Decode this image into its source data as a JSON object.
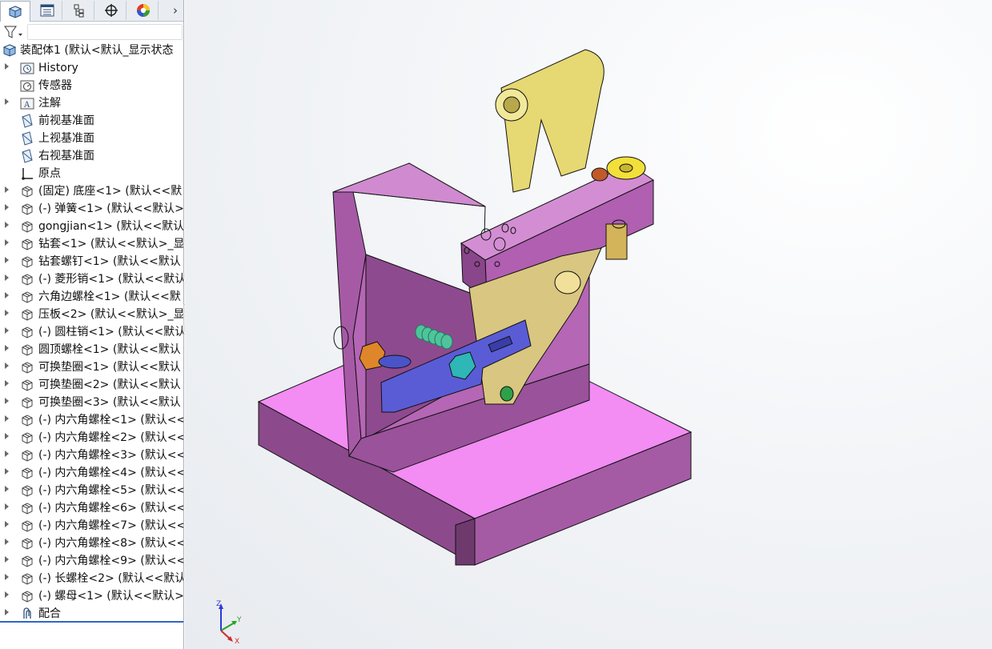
{
  "tabs": [
    {
      "name": "feature-manager-tab",
      "icon": "feature-manager-icon",
      "active": true
    },
    {
      "name": "property-manager-tab",
      "icon": "property-manager-icon",
      "active": false
    },
    {
      "name": "configuration-manager-tab",
      "icon": "configuration-manager-icon",
      "active": false
    },
    {
      "name": "dimxpert-manager-tab",
      "icon": "crosshair-icon",
      "active": false
    },
    {
      "name": "display-manager-tab",
      "icon": "display-manager-icon",
      "active": false
    }
  ],
  "tabs_more": "›",
  "filter": {
    "icon": "filter-icon",
    "value": ""
  },
  "tree": {
    "root": "装配体1  (默认<默认_显示状态",
    "items": [
      {
        "label": "History",
        "icon": "history-folder-icon",
        "expandable": true
      },
      {
        "label": "传感器",
        "icon": "sensor-folder-icon",
        "expandable": false
      },
      {
        "label": "注解",
        "icon": "annotation-folder-icon",
        "expandable": true
      },
      {
        "label": "前视基准面",
        "icon": "plane-icon",
        "expandable": false
      },
      {
        "label": "上视基准面",
        "icon": "plane-icon",
        "expandable": false
      },
      {
        "label": "右视基准面",
        "icon": "plane-icon",
        "expandable": false
      },
      {
        "label": "原点",
        "icon": "origin-icon",
        "expandable": false
      },
      {
        "label": "(固定) 底座<1> (默认<<默",
        "icon": "part-icon",
        "expandable": true
      },
      {
        "label": "(-) 弹簧<1> (默认<<默认>",
        "icon": "part-icon",
        "expandable": true
      },
      {
        "label": "gongjian<1> (默认<<默认",
        "icon": "part-icon",
        "expandable": true
      },
      {
        "label": "钻套<1> (默认<<默认>_显",
        "icon": "part-icon",
        "expandable": true
      },
      {
        "label": "钻套螺钉<1> (默认<<默认",
        "icon": "part-icon",
        "expandable": true
      },
      {
        "label": "(-) 菱形销<1> (默认<<默认",
        "icon": "part-icon",
        "expandable": true
      },
      {
        "label": "六角边螺栓<1> (默认<<默",
        "icon": "part-icon",
        "expandable": true
      },
      {
        "label": "压板<2> (默认<<默认>_显",
        "icon": "part-icon",
        "expandable": true
      },
      {
        "label": "(-) 圆柱销<1> (默认<<默认",
        "icon": "part-icon",
        "expandable": true
      },
      {
        "label": "圆顶螺栓<1> (默认<<默认",
        "icon": "part-icon",
        "expandable": true
      },
      {
        "label": "可换垫圈<1> (默认<<默认",
        "icon": "part-icon",
        "expandable": true
      },
      {
        "label": "可换垫圈<2> (默认<<默认",
        "icon": "part-icon",
        "expandable": true
      },
      {
        "label": "可换垫圈<3> (默认<<默认",
        "icon": "part-icon",
        "expandable": true
      },
      {
        "label": "(-) 内六角螺栓<1> (默认<<",
        "icon": "part-icon",
        "expandable": true
      },
      {
        "label": "(-) 内六角螺栓<2> (默认<<",
        "icon": "part-icon",
        "expandable": true
      },
      {
        "label": "(-) 内六角螺栓<3> (默认<<",
        "icon": "part-icon",
        "expandable": true
      },
      {
        "label": "(-) 内六角螺栓<4> (默认<<",
        "icon": "part-icon",
        "expandable": true
      },
      {
        "label": "(-) 内六角螺栓<5> (默认<<",
        "icon": "part-icon",
        "expandable": true
      },
      {
        "label": "(-) 内六角螺栓<6> (默认<<",
        "icon": "part-icon",
        "expandable": true
      },
      {
        "label": "(-) 内六角螺栓<7> (默认<<",
        "icon": "part-icon",
        "expandable": true
      },
      {
        "label": "(-) 内六角螺栓<8> (默认<<",
        "icon": "part-icon",
        "expandable": true
      },
      {
        "label": "(-) 内六角螺栓<9> (默认<<",
        "icon": "part-icon",
        "expandable": true
      },
      {
        "label": "(-) 长螺栓<2> (默认<<默认",
        "icon": "part-icon",
        "expandable": true
      },
      {
        "label": "(-) 螺母<1> (默认<<默认>",
        "icon": "part-icon",
        "expandable": true
      },
      {
        "label": "配合",
        "icon": "mates-icon",
        "expandable": true
      }
    ]
  },
  "sash_grip": "‹",
  "triad": {
    "z": "Z",
    "y": "Y",
    "x": "X"
  },
  "colors": {
    "base_body": "#ee84ee",
    "base_shadow": "#a45ba4",
    "base_dark": "#7a3f7a",
    "yellow_part": "#e6d872",
    "blue_plate": "#5a5cd6",
    "spring": "#4fc49c",
    "nut_orange": "#e0862a"
  }
}
